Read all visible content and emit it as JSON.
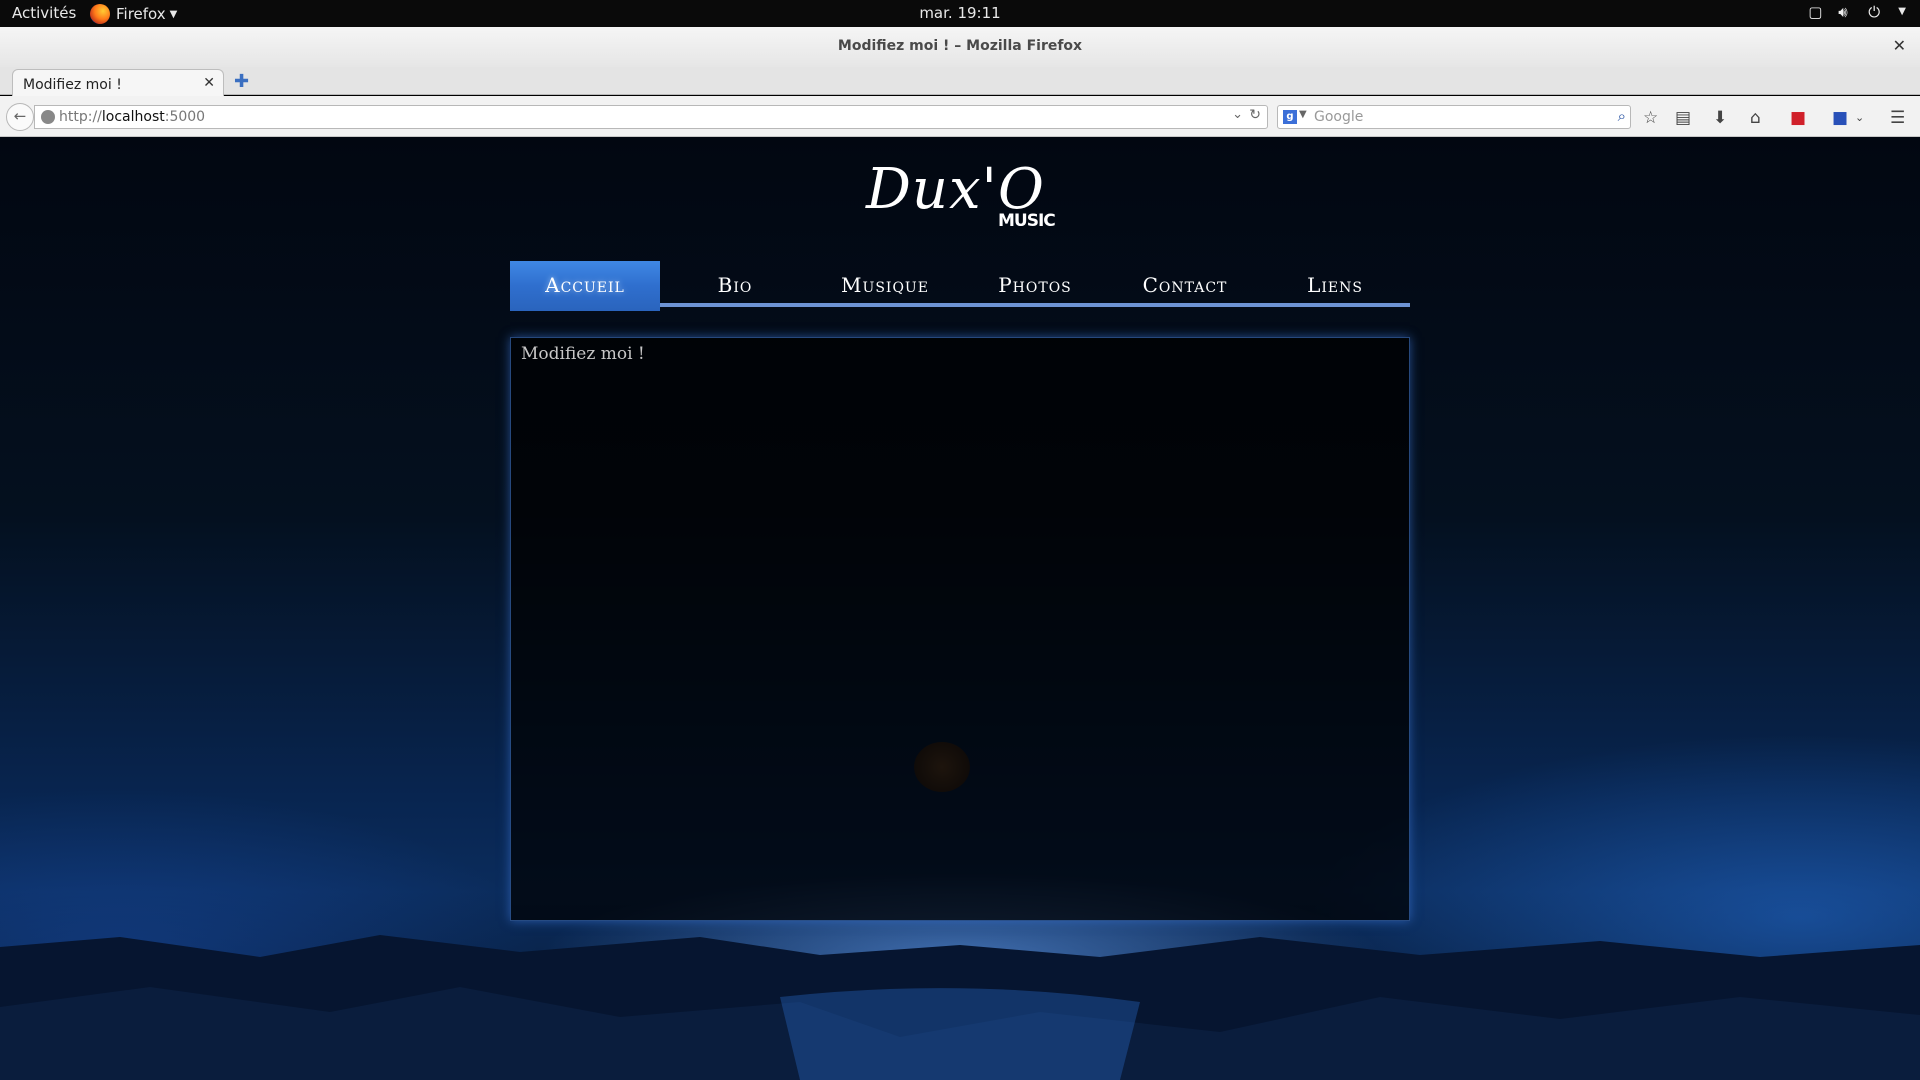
{
  "system_bar": {
    "activities": "Activités",
    "app_name": "Firefox",
    "clock": "mar. 19:11"
  },
  "window": {
    "title": "Modifiez moi ! – Mozilla Firefox"
  },
  "tabs": [
    {
      "label": "Modifiez moi !"
    }
  ],
  "navbar": {
    "url_scheme": "http://",
    "url_host": "localhost",
    "url_port": ":5000",
    "search_placeholder": "Google",
    "search_engine_letter": "g"
  },
  "site": {
    "logo_text": "Dux'O",
    "logo_sub": "MUSIC",
    "menu": [
      {
        "label": "Accueil",
        "active": true
      },
      {
        "label": "Bio",
        "active": false
      },
      {
        "label": "Musique",
        "active": false
      },
      {
        "label": "Photos",
        "active": false
      },
      {
        "label": "Contact",
        "active": false
      },
      {
        "label": "Liens",
        "active": false
      }
    ],
    "content_text": "Modifiez moi !"
  }
}
